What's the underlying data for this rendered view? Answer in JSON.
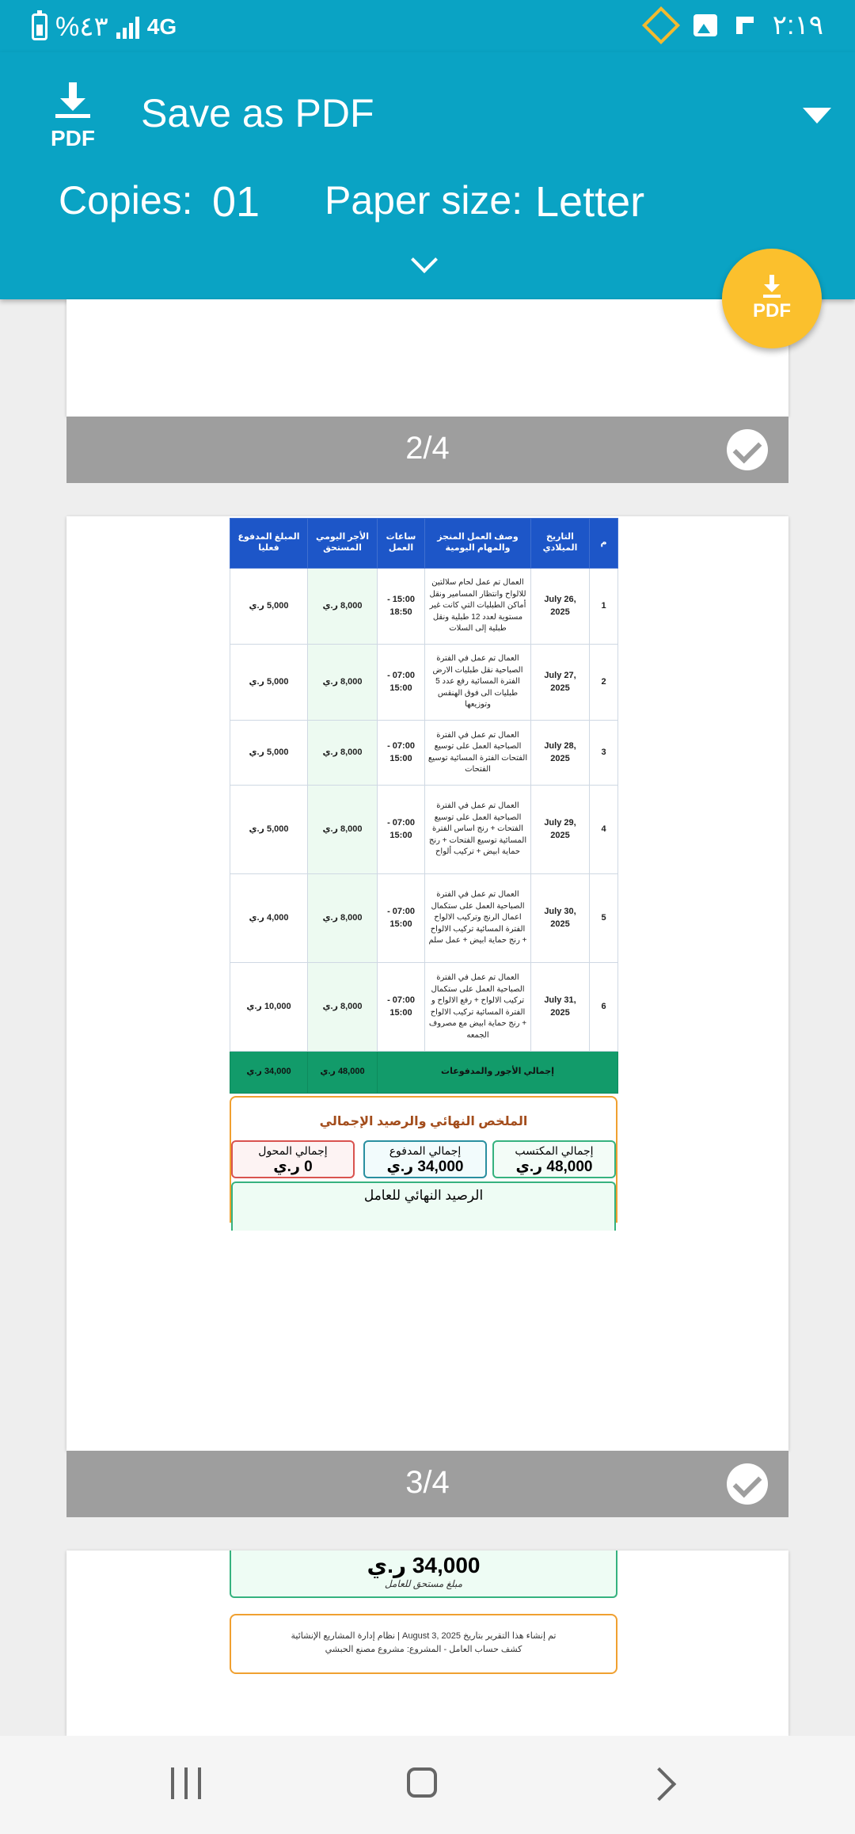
{
  "status_bar": {
    "battery_text": "%٤٣",
    "network": "4G",
    "time": "٢:١٩"
  },
  "header": {
    "title": "Save as PDF",
    "icon_label": "PDF",
    "copies_label": "Copies:",
    "copies_value": "01",
    "paper_label": "Paper size:",
    "paper_value": "Letter"
  },
  "fab": {
    "label": "PDF"
  },
  "pages": {
    "page2_indicator": "2/4",
    "page3_indicator": "3/4"
  },
  "table": {
    "headers": [
      "م",
      "التاريخ الميلادي",
      "وصف العمل المنجز والمهام اليومية",
      "ساعات العمل",
      "الأجر اليومي المستحق",
      "المبلغ المدفوع فعليا"
    ],
    "rows": [
      {
        "n": "1",
        "date": "July 26, 2025",
        "desc": "العمال تم عمل لحام سلالتين للالواح وانتظار المسامير ونقل أماكن الطبليات التي كانت غير مستوية لعدد 12 طبلية ونقل طبلية إلى السلات",
        "hours": "15:00 - 18:50",
        "wage": "8,000 ر.ي",
        "paid": "5,000 ر.ي"
      },
      {
        "n": "2",
        "date": "July 27, 2025",
        "desc": "العمال تم عمل في الفترة الصباحية نقل طبليات الارض الفترة المسائية رفع عدد 5 طبليات الى فوق الهنقس وتوزيعها",
        "hours": "07:00 - 15:00",
        "wage": "8,000 ر.ي",
        "paid": "5,000 ر.ي"
      },
      {
        "n": "3",
        "date": "July 28, 2025",
        "desc": "العمال تم عمل في الفترة الصباحية العمل على توسيع الفتحات الفترة المسائية توسيع الفتحات",
        "hours": "07:00 - 15:00",
        "wage": "8,000 ر.ي",
        "paid": "5,000 ر.ي"
      },
      {
        "n": "4",
        "date": "July 29, 2025",
        "desc": "العمال تم عمل في الفترة الصباحية العمل على توسيع الفتحات + رنج اساس الفترة المسائية توسيع الفتحات + رنج حماية ابيض + تركيب ألواح",
        "hours": "07:00 - 15:00",
        "wage": "8,000 ر.ي",
        "paid": "5,000 ر.ي"
      },
      {
        "n": "5",
        "date": "July 30, 2025",
        "desc": "العمال تم عمل في الفترة الصباحية العمل على ستكمال اعمال الرنج وتركيب الالواح الفترة المسائية تركيب الالواح + رنج حماية ابيض + عمل سلم",
        "hours": "07:00 - 15:00",
        "wage": "8,000 ر.ي",
        "paid": "4,000 ر.ي"
      },
      {
        "n": "6",
        "date": "July 31, 2025",
        "desc": "العمال تم عمل في الفترة الصباحية العمل على ستكمال تركيب الالواح + رفع الالواح و الفترة المسائية تركيب الالواح + رنج حماية ابيض مع مصروف الجمعه",
        "hours": "07:00 - 15:00",
        "wage": "8,000 ر.ي",
        "paid": "10,000 ر.ي"
      }
    ],
    "total_label": "إجمالي الأجور والمدفوعات",
    "total_wage": "48,000 ر.ي",
    "total_paid": "34,000 ر.ي"
  },
  "summary": {
    "title": "الملخص النهائي والرصيد الإجمالي",
    "earned_label": "إجمالي المكتسب",
    "earned_value": "48,000 ر.ي",
    "paid_label": "إجمالي المدفوع",
    "paid_value": "34,000 ر.ي",
    "transfer_label": "إجمالي المحول",
    "transfer_value": "0 ر.ي",
    "final_label": "الرصيد النهائي للعامل",
    "final_value": "34,000 ر.ي",
    "final_note": "مبلغ مستحق للعامل"
  },
  "footer_note": {
    "line1": "تم إنشاء هذا التقرير بتاريخ August 3, 2025 | نظام إدارة المشاريع الإنشائية",
    "line2": "كشف حساب العامل - المشروع: مشروع مصنع الحبشي"
  },
  "colors": {
    "header_bg": "#0aa3c4",
    "fab_bg": "#fbc02d",
    "table_header": "#1d56c8",
    "total_row": "#129b6a"
  }
}
